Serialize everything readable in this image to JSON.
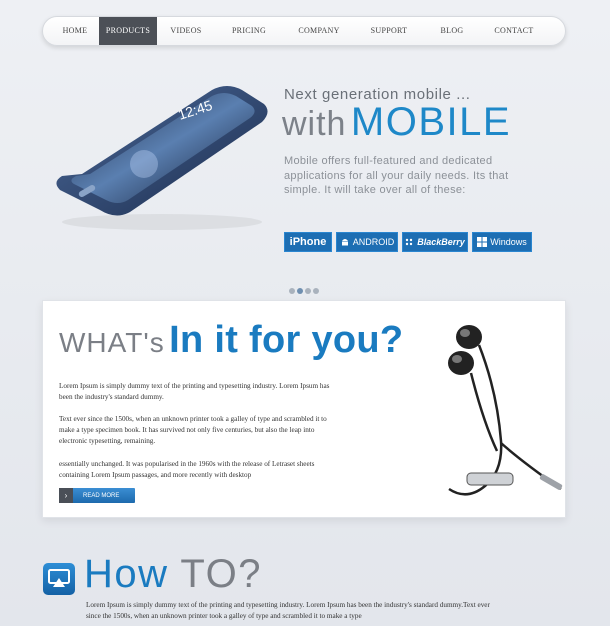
{
  "nav": {
    "items": [
      {
        "label": "HOME",
        "active": false
      },
      {
        "label": "PRODUCTS",
        "active": true
      },
      {
        "label": "VIDEOS",
        "active": false
      },
      {
        "label": "PRICING",
        "active": false
      },
      {
        "label": "COMPANY",
        "active": false
      },
      {
        "label": "SUPPORT",
        "active": false
      },
      {
        "label": "BLOG",
        "active": false
      },
      {
        "label": "CONTACT",
        "active": false
      }
    ]
  },
  "hero": {
    "subtitle": "Next generation mobile ...",
    "title_with": "with",
    "title_mobile": "MOBILE",
    "description": "Mobile offers full-featured and dedicated applications for all your daily needs. Its that simple. It will take over all of these:",
    "phone_time": "12:45",
    "platforms": [
      {
        "label": "iPhone",
        "icon": "apple-icon"
      },
      {
        "label": "ANDROID",
        "icon": "android-icon"
      },
      {
        "label": "BlackBerry",
        "icon": "blackberry-icon"
      },
      {
        "label": "Windows",
        "icon": "windows-icon"
      }
    ]
  },
  "slider": {
    "count": 4,
    "active_index": 1
  },
  "feature": {
    "title_small": "WHAT's",
    "title_big": "In it for you?",
    "paragraphs": [
      "Lorem Ipsum is simply dummy text of the printing and typesetting industry. Lorem Ipsum has been the industry's standard dummy.",
      "Text ever since the 1500s, when an unknown printer took a galley of type and scrambled it to make a type specimen book. It has survived not only five centuries, but also the leap into electronic typesetting, remaining.",
      " essentially unchanged. It was popularised in the 1960s with the release of Letraset sheets containing Lorem Ipsum passages, and more recently with desktop"
    ],
    "read_more": "READ MORE"
  },
  "howto": {
    "title_how": "How",
    "title_to": "TO?",
    "text": "Lorem Ipsum is simply dummy text of the printing and typesetting industry. Lorem Ipsum has been the industry's standard dummy.Text ever since the 1500s, when an unknown printer took a galley of type and scrambled it to make a type"
  },
  "colors": {
    "accent": "#1a7bc0",
    "nav_active": "#4c5057",
    "button": "#1d6eb3"
  }
}
